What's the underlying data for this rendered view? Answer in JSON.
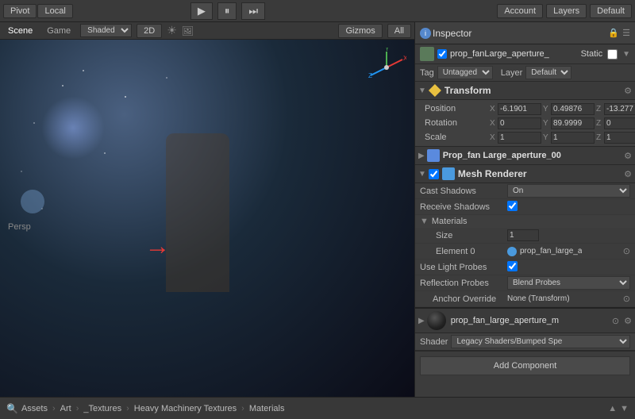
{
  "toolbar": {
    "pivot_label": "Pivot",
    "local_label": "Local",
    "play_icon": "▶",
    "pause_icon": "⏸",
    "step_icon": "⏭",
    "account_label": "Account",
    "layers_label": "Layers",
    "default_label": "Default"
  },
  "scene": {
    "tabs": [
      {
        "label": "Scene",
        "active": true
      },
      {
        "label": "Game",
        "active": false
      }
    ],
    "shading_label": "Shaded",
    "mode_label": "2D",
    "gizmos_label": "Gizmos",
    "all_label": "All",
    "persp_label": "Persp"
  },
  "inspector": {
    "title": "Inspector",
    "lock_icon": "🔒",
    "menu_icon": "☰",
    "object_name": "prop_fanLarge_aperture_",
    "static_label": "Static",
    "tag_label": "Tag",
    "tag_value": "Untagged",
    "layer_label": "Layer",
    "layer_value": "Default",
    "transform": {
      "title": "Transform",
      "position_label": "Position",
      "pos_x": "-6.1901",
      "pos_y": "0.49876",
      "pos_z": "-13.277",
      "rotation_label": "Rotation",
      "rot_x": "0",
      "rot_y": "89.9999",
      "rot_z": "0",
      "scale_label": "Scale",
      "scale_x": "1",
      "scale_y": "1",
      "scale_z": "1"
    },
    "prop_fan": {
      "title": "Prop_fan Large_aperture_00"
    },
    "mesh_renderer": {
      "title": "Mesh Renderer",
      "cast_shadows_label": "Cast Shadows",
      "cast_shadows_value": "On",
      "receive_shadows_label": "Receive Shadows",
      "materials_label": "Materials",
      "size_label": "Size",
      "size_value": "1",
      "element0_label": "Element 0",
      "element0_value": "prop_fan_large_a",
      "use_light_probes_label": "Use Light Probes",
      "reflection_probes_label": "Reflection Probes",
      "reflection_probes_value": "Blend Probes",
      "anchor_override_label": "Anchor Override",
      "anchor_override_value": "None (Transform)"
    },
    "material": {
      "name": "prop_fan_large_aperture_m",
      "shader_label": "Shader",
      "shader_value": "Legacy Shaders/Bumped Spe"
    },
    "add_component_label": "Add Component"
  },
  "bottom": {
    "breadcrumbs": [
      "Assets",
      "Art",
      "_Textures",
      "Heavy Machinery Textures",
      "Materials"
    ]
  }
}
